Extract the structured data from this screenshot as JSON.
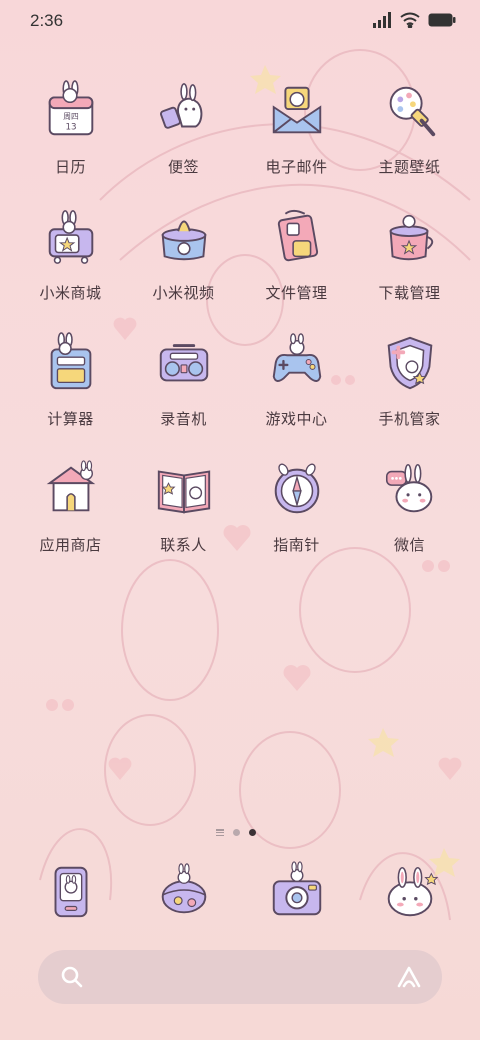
{
  "status_bar": {
    "time": "2:36",
    "icons": [
      "signal-icon",
      "wifi-icon",
      "battery-icon"
    ]
  },
  "apps": [
    {
      "label": "日历",
      "icon": "calendar-icon",
      "calendar_weekday": "周四",
      "calendar_day": "13"
    },
    {
      "label": "便签",
      "icon": "notes-icon"
    },
    {
      "label": "电子邮件",
      "icon": "email-icon"
    },
    {
      "label": "主题壁纸",
      "icon": "themes-icon"
    },
    {
      "label": "小米商城",
      "icon": "mi-store-icon"
    },
    {
      "label": "小米视频",
      "icon": "mi-video-icon"
    },
    {
      "label": "文件管理",
      "icon": "file-manager-icon"
    },
    {
      "label": "下载管理",
      "icon": "downloads-icon"
    },
    {
      "label": "计算器",
      "icon": "calculator-icon"
    },
    {
      "label": "录音机",
      "icon": "recorder-icon"
    },
    {
      "label": "游戏中心",
      "icon": "game-center-icon"
    },
    {
      "label": "手机管家",
      "icon": "security-icon"
    },
    {
      "label": "应用商店",
      "icon": "app-store-icon"
    },
    {
      "label": "联系人",
      "icon": "contacts-icon"
    },
    {
      "label": "指南针",
      "icon": "compass-icon"
    },
    {
      "label": "微信",
      "icon": "wechat-icon"
    }
  ],
  "page_indicator": {
    "pages": 2,
    "active_page": 2
  },
  "dock": [
    {
      "icon": "phone-icon"
    },
    {
      "icon": "messages-icon"
    },
    {
      "icon": "camera-icon"
    },
    {
      "icon": "browser-icon"
    }
  ],
  "search_bar": {
    "left_icon": "search-icon",
    "right_icon": "assistant-icon"
  },
  "colors": {
    "background": "#f8d7d9",
    "icon_outline": "#5b4a62",
    "icon_purple": "#b9a6e6",
    "icon_pink": "#f3a9b8",
    "icon_yellow": "#f6d77b",
    "icon_blue": "#a9c4ee",
    "label_text": "#4a3a40"
  }
}
